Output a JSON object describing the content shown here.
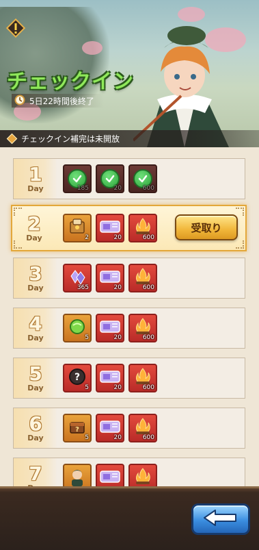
{
  "banner": {
    "title": "チェックイン",
    "timer_text": "5日22時間後終了",
    "notice_text": "チェックイン補完は未開放"
  },
  "day_label": "Day",
  "claim_label": "受取り",
  "days": [
    {
      "num": "1",
      "state": "claimed",
      "items": [
        {
          "icon": "claimed-item-icon",
          "qty": "185"
        },
        {
          "icon": "claimed-item-icon",
          "qty": "20"
        },
        {
          "icon": "claimed-item-icon",
          "qty": "600"
        }
      ]
    },
    {
      "num": "2",
      "state": "claimable",
      "items": [
        {
          "icon": "scroll-chest-icon",
          "qty": "2"
        },
        {
          "icon": "ticket-icon",
          "qty": "20"
        },
        {
          "icon": "campfire-icon",
          "qty": "600"
        }
      ]
    },
    {
      "num": "3",
      "state": "locked",
      "items": [
        {
          "icon": "crystal-icon",
          "qty": "365"
        },
        {
          "icon": "ticket-icon",
          "qty": "20"
        },
        {
          "icon": "campfire-icon",
          "qty": "600"
        }
      ]
    },
    {
      "num": "4",
      "state": "locked",
      "items": [
        {
          "icon": "green-orb-icon",
          "qty": "5"
        },
        {
          "icon": "ticket-icon",
          "qty": "20"
        },
        {
          "icon": "campfire-icon",
          "qty": "600"
        }
      ]
    },
    {
      "num": "5",
      "state": "locked",
      "items": [
        {
          "icon": "mystery-gear-icon",
          "qty": "5"
        },
        {
          "icon": "ticket-icon",
          "qty": "20"
        },
        {
          "icon": "campfire-icon",
          "qty": "600"
        }
      ]
    },
    {
      "num": "6",
      "state": "locked",
      "items": [
        {
          "icon": "mystery-chest-icon",
          "qty": "5"
        },
        {
          "icon": "ticket-icon",
          "qty": "20"
        },
        {
          "icon": "campfire-icon",
          "qty": "600"
        }
      ]
    },
    {
      "num": "7",
      "state": "locked",
      "items": [
        {
          "icon": "character-icon",
          "qty": ""
        },
        {
          "icon": "ticket-icon",
          "qty": ""
        },
        {
          "icon": "campfire-icon",
          "qty": ""
        }
      ]
    }
  ],
  "colors": {
    "title_green": "#8fe85a",
    "item_red": "#d83a33",
    "highlight_gold": "#e3a73a",
    "back_blue": "#3b8ee0"
  }
}
